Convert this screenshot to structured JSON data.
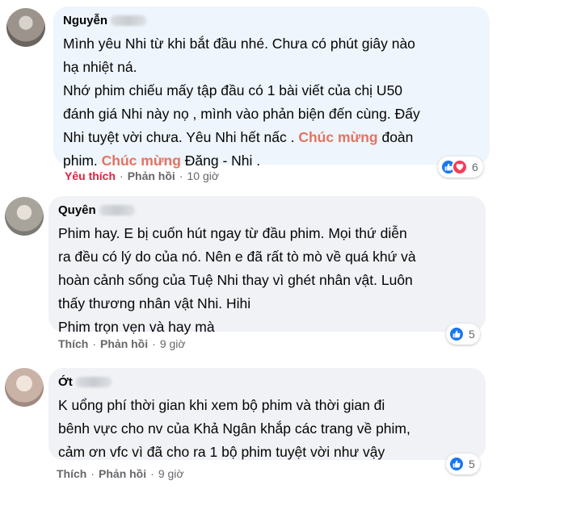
{
  "comments": [
    {
      "author": "Nguyễn",
      "lines": [
        [
          {
            "t": "Mình yêu Nhi từ khi bắt đầu nhé. Chưa có phút giây nào"
          }
        ],
        [
          {
            "t": "hạ nhiệt ná."
          }
        ],
        [
          {
            "t": "Nhớ phim chiếu mấy tập đầu có 1 bài viết của chị U50"
          }
        ],
        [
          {
            "t": "đánh giá Nhi này nọ , mình vào phản biện đến cùng. Đấy"
          }
        ],
        [
          {
            "t": "Nhi tuyệt vời chưa. Yêu Nhi hết nấc . "
          },
          {
            "t": "Chúc mừng",
            "hl": true
          },
          {
            "t": " đoàn"
          }
        ],
        [
          {
            "t": "phim. "
          },
          {
            "t": "Chúc mừng",
            "hl": true
          },
          {
            "t": " Đăng - Nhi ."
          }
        ]
      ],
      "like_label": "Yêu thích",
      "reply_label": "Phản hồi",
      "time": "10 giờ",
      "reaction_count": "6",
      "reactions": [
        "like-icon",
        "love-icon"
      ]
    },
    {
      "author": "Quyên",
      "lines": [
        [
          {
            "t": "Phim hay. E bị cuốn hút ngay từ đầu phim. Mọi thứ diễn"
          }
        ],
        [
          {
            "t": "ra đều có lý do của nó. Nên e đã rất tò mò về quá khứ và"
          }
        ],
        [
          {
            "t": "hoàn cảnh sống của Tuệ Nhi thay vì ghét nhân vật. Luôn"
          }
        ],
        [
          {
            "t": "thấy thương nhân vật Nhi. Hihi"
          }
        ],
        [
          {
            "t": "Phim trọn vẹn và hay mà"
          }
        ]
      ],
      "like_label": "Thích",
      "reply_label": "Phản hồi",
      "time": "9 giờ",
      "reaction_count": "5",
      "reactions": [
        "like-icon"
      ]
    },
    {
      "author": "Ớt",
      "lines": [
        [
          {
            "t": "K uổng phí thời gian khi xem bộ phim và thời gian đi"
          }
        ],
        [
          {
            "t": "bênh vực cho nv của Khả Ngân khắp các trang về phim,"
          }
        ],
        [
          {
            "t": "cảm ơn vfc vì đã cho ra 1 bộ phim tuyệt vời như vậy"
          }
        ]
      ],
      "like_label": "Thích",
      "reply_label": "Phản hồi",
      "time": "9 giờ",
      "reaction_count": "5",
      "reactions": [
        "like-icon"
      ]
    }
  ],
  "colors": {
    "bubble": "#f0f2f5",
    "bubble_highlight": "#eef5fc",
    "highlight_text": "#e4735f",
    "liked": "#e41e3f",
    "meta": "#65676b",
    "like_blue": "#1877f2",
    "love_red": "#f33e58"
  }
}
